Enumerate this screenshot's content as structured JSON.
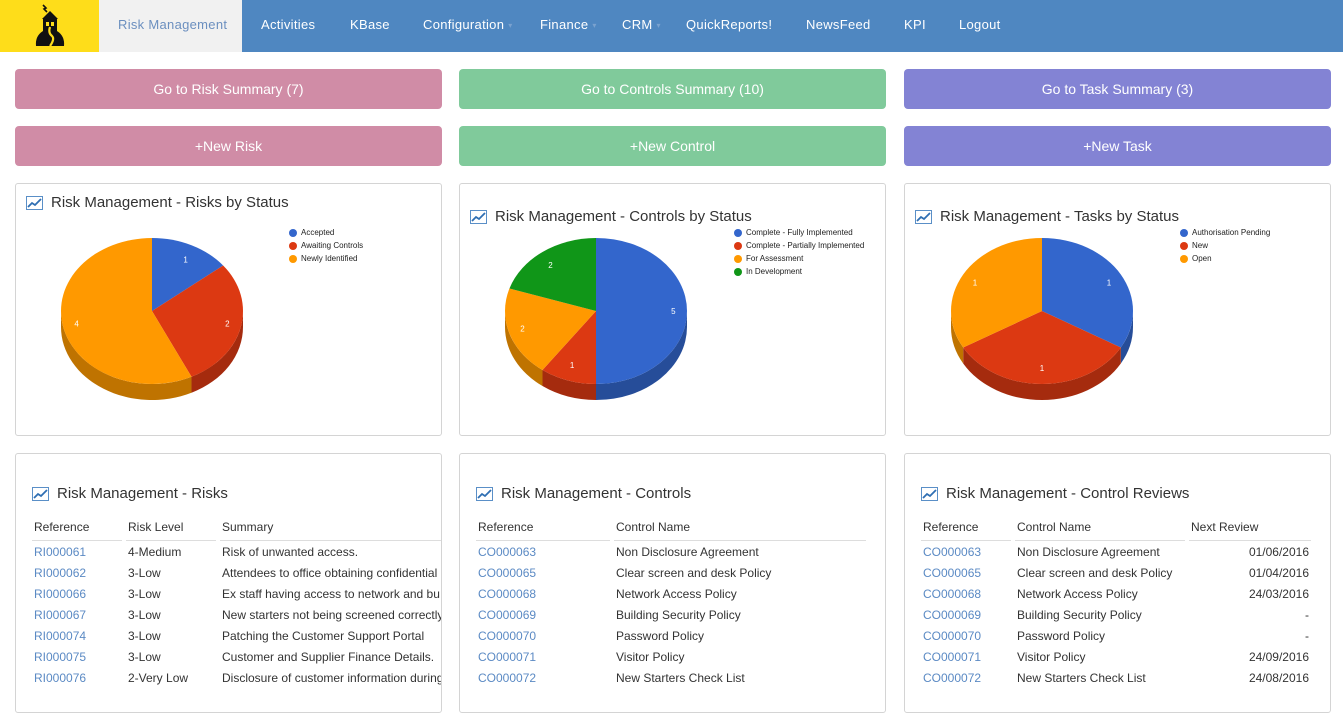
{
  "nav": {
    "logo_icon": "lighthouse-logo-icon",
    "items": [
      {
        "label": "Risk Management",
        "active": true,
        "dropdown": false
      },
      {
        "label": "Activities",
        "dropdown": false
      },
      {
        "label": "KBase",
        "dropdown": false
      },
      {
        "label": "Configuration",
        "dropdown": true
      },
      {
        "label": "Finance",
        "dropdown": true
      },
      {
        "label": "CRM",
        "dropdown": true
      },
      {
        "label": "QuickReports!",
        "dropdown": false
      },
      {
        "label": "NewsFeed",
        "dropdown": false
      },
      {
        "label": "KPI",
        "dropdown": false
      },
      {
        "label": "Logout",
        "dropdown": false
      }
    ],
    "caret": "▾"
  },
  "buttons": {
    "risk_summary": "Go to Risk Summary (7)",
    "controls_summary": "Go to Controls Summary (10)",
    "task_summary": "Go to Task Summary (3)",
    "new_risk": "+New Risk",
    "new_control": "+New Control",
    "new_task": "+New Task"
  },
  "colors": {
    "nav_bg": "#4f87c1",
    "logo_bg": "#fedd1a",
    "risk": "#d08ca6",
    "control": "#80ca9b",
    "task": "#8383d4",
    "link": "#5b8ac4"
  },
  "chart_data": [
    {
      "type": "pie",
      "title": "Risk Management - Risks by Status",
      "legend_position": "top-right",
      "three_d": true,
      "categories": [
        "Accepted",
        "Awaiting Controls",
        "Newly Identified"
      ],
      "values": [
        1,
        2,
        4
      ],
      "colors": [
        "#3366cc",
        "#dc3912",
        "#ff9900"
      ]
    },
    {
      "type": "pie",
      "title": "Risk Management - Controls by Status",
      "legend_position": "top-right",
      "three_d": true,
      "categories": [
        "Complete - Fully Implemented",
        "Complete - Partially Implemented",
        "For Assessment",
        "In Development"
      ],
      "values": [
        5,
        1,
        2,
        2
      ],
      "colors": [
        "#3366cc",
        "#dc3912",
        "#ff9900",
        "#109618"
      ]
    },
    {
      "type": "pie",
      "title": "Risk Management - Tasks by Status",
      "legend_position": "top-right",
      "three_d": true,
      "categories": [
        "Authorisation Pending",
        "New",
        "Open"
      ],
      "values": [
        1,
        1,
        1
      ],
      "colors": [
        "#3366cc",
        "#dc3912",
        "#ff9900"
      ]
    }
  ],
  "risks_table": {
    "title": "Risk Management - Risks",
    "columns": [
      "Reference",
      "Risk Level",
      "Summary"
    ],
    "rows": [
      [
        "RI000061",
        "4-Medium",
        "Risk of unwanted access."
      ],
      [
        "RI000062",
        "3-Low",
        "Attendees to office obtaining confidential"
      ],
      [
        "RI000066",
        "3-Low",
        "Ex staff having access to network and bu"
      ],
      [
        "RI000067",
        "3-Low",
        "New starters not being screened correctly"
      ],
      [
        "RI000074",
        "3-Low",
        "Patching the Customer Support Portal"
      ],
      [
        "RI000075",
        "3-Low",
        "Customer and Supplier Finance Details."
      ],
      [
        "RI000076",
        "2-Very Low",
        "Disclosure of customer information during"
      ]
    ]
  },
  "controls_table": {
    "title": "Risk Management - Controls",
    "columns": [
      "Reference",
      "Control Name"
    ],
    "rows": [
      [
        "CO000063",
        "Non Disclosure Agreement"
      ],
      [
        "CO000065",
        "Clear screen and desk Policy"
      ],
      [
        "CO000068",
        "Network Access Policy"
      ],
      [
        "CO000069",
        "Building Security Policy"
      ],
      [
        "CO000070",
        "Password Policy"
      ],
      [
        "CO000071",
        "Visitor Policy"
      ],
      [
        "CO000072",
        "New Starters Check List"
      ]
    ]
  },
  "reviews_table": {
    "title": "Risk Management - Control Reviews",
    "columns": [
      "Reference",
      "Control Name",
      "Next Review"
    ],
    "rows": [
      [
        "CO000063",
        "Non Disclosure Agreement",
        "01/06/2016"
      ],
      [
        "CO000065",
        "Clear screen and desk Policy",
        "01/04/2016"
      ],
      [
        "CO000068",
        "Network Access Policy",
        "24/03/2016"
      ],
      [
        "CO000069",
        "Building Security Policy",
        "-"
      ],
      [
        "CO000070",
        "Password Policy",
        "-"
      ],
      [
        "CO000071",
        "Visitor Policy",
        "24/09/2016"
      ],
      [
        "CO000072",
        "New Starters Check List",
        "24/08/2016"
      ]
    ]
  }
}
